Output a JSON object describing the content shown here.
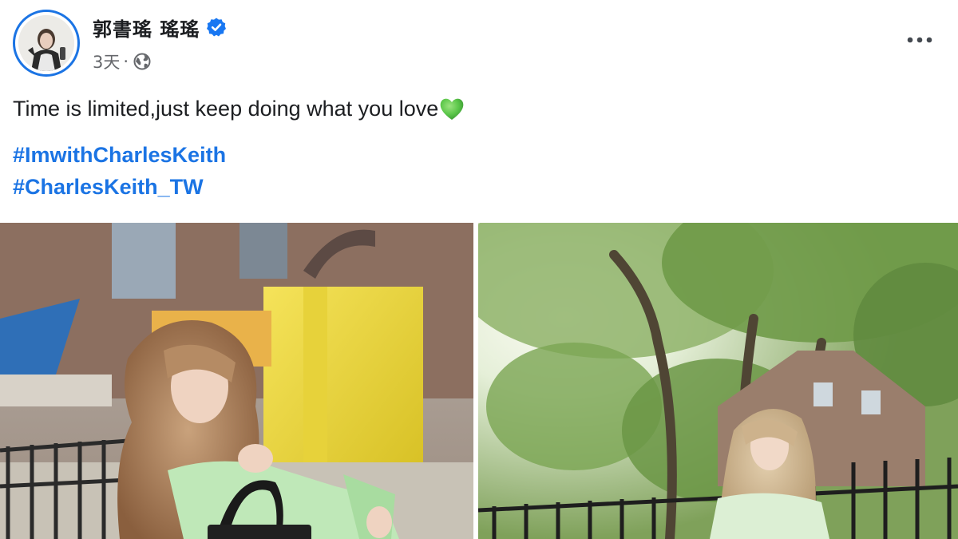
{
  "post": {
    "author": {
      "name": "郭書瑤 瑤瑤",
      "verified": true
    },
    "timestamp": "3天",
    "separator": "·",
    "audience_icon": "globe-icon",
    "message": "Time is limited,just keep doing what you love",
    "emoji": "green-heart",
    "hashtags": [
      "#ImwithCharlesKeith",
      "#CharlesKeith_TW"
    ],
    "photos": [
      {
        "name": "photo-left",
        "description_icon": "photo"
      },
      {
        "name": "photo-right",
        "description_icon": "photo"
      }
    ]
  },
  "colors": {
    "accent": "#1b74e4",
    "text_primary": "#1c1e21",
    "text_secondary": "#65676b",
    "heart_green": "#5cc74a",
    "verified_blue": "#1877f2"
  }
}
